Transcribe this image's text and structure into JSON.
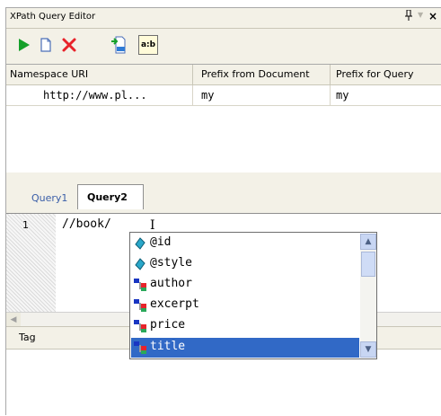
{
  "window": {
    "title": "XPath Query Editor",
    "pin_glyph": "↑",
    "menu_glyph": "▼",
    "close_glyph": "×"
  },
  "toolbar": {
    "buttons": [
      {
        "icon": "run-icon",
        "color": "#15a02a"
      },
      {
        "icon": "new-document-icon"
      },
      {
        "icon": "delete-icon",
        "color": "#e8232a"
      },
      {
        "icon": "xml-import-icon"
      },
      {
        "icon": "namespace-prefix-icon",
        "label": "a:b"
      }
    ]
  },
  "namespaces": {
    "columns": [
      "Namespace URI",
      "Prefix from Document",
      "Prefix for Query"
    ],
    "rows": [
      {
        "uri": "http://www.pl...",
        "doc_prefix": "my",
        "query_prefix": "my"
      }
    ]
  },
  "tabs": [
    {
      "label": "Query1",
      "active": false
    },
    {
      "label": "Query2",
      "active": true
    }
  ],
  "editor": {
    "line_number": "1",
    "code": "//book/",
    "cursor_glyph": "I"
  },
  "autocomplete": {
    "selected": "title",
    "items": [
      {
        "label": "@id",
        "kind": "attribute"
      },
      {
        "label": "@style",
        "kind": "attribute"
      },
      {
        "label": "author",
        "kind": "element"
      },
      {
        "label": "excerpt",
        "kind": "element"
      },
      {
        "label": "price",
        "kind": "element"
      },
      {
        "label": "title",
        "kind": "element",
        "selected": true
      }
    ],
    "scroll_up_glyph": "▲",
    "scroll_down_glyph": "▼"
  },
  "hscroll": {
    "left_glyph": "◀"
  },
  "results": {
    "column": "Tag"
  },
  "colors": {
    "selection": "#3169c6",
    "panel": "#f3f1e7",
    "tab_inactive": "#3a5ea8"
  }
}
